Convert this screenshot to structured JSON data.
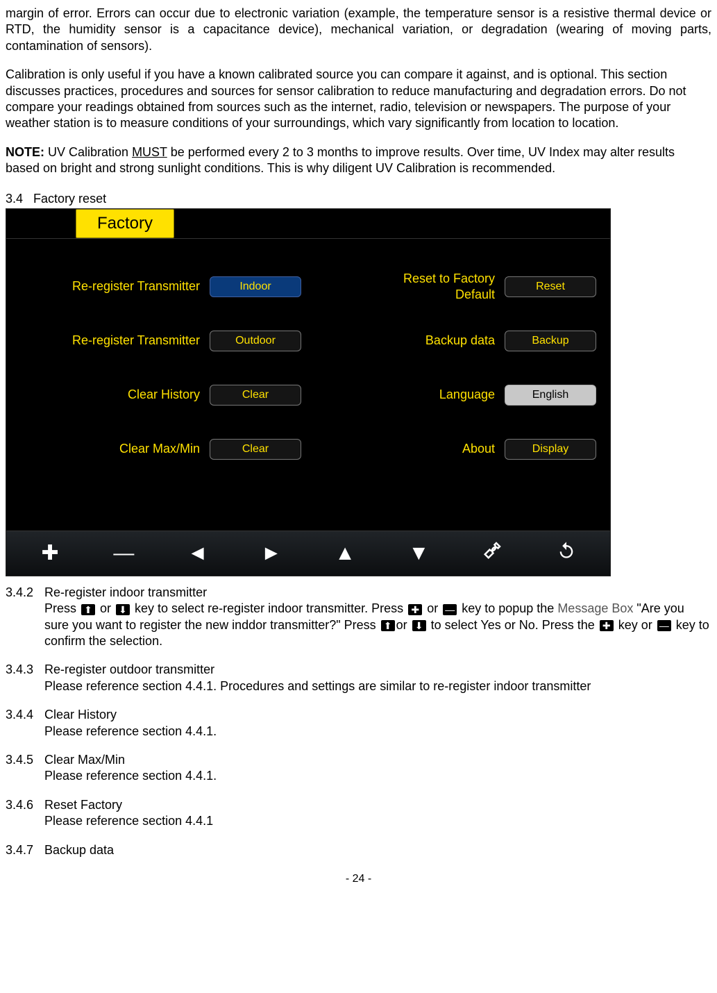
{
  "intro": {
    "p1": "margin of error. Errors can occur due to electronic variation (example, the temperature sensor is a resistive thermal device or RTD, the humidity sensor is a capacitance device), mechanical variation, or degradation (wearing of moving parts, contamination of sensors).",
    "p2": "Calibration is only useful if you have a known calibrated source you can compare it against, and is optional. This section discusses practices, procedures and sources for sensor calibration to reduce manufacturing and degradation errors. Do not compare your readings obtained from sources such as the internet, radio, television or newspapers. The purpose of your weather station is to measure conditions of your surroundings, which vary significantly from location to location.",
    "note_label": "NOTE:",
    "note_pre": " UV Calibration ",
    "note_must": "MUST",
    "note_post": " be performed every 2 to 3 months to improve results. Over time, UV Index may alter results based on bright and strong sunlight conditions. This is why diligent UV Calibration is recommended."
  },
  "section34": {
    "num": "3.4",
    "title": "Factory reset"
  },
  "factory": {
    "tab": "Factory",
    "left": [
      {
        "label": "Re-register Transmitter",
        "button": "Indoor",
        "style": "sel"
      },
      {
        "label": "Re-register Transmitter",
        "button": "Outdoor",
        "style": "dark"
      },
      {
        "label": "Clear History",
        "button": "Clear",
        "style": "dark"
      },
      {
        "label": "Clear Max/Min",
        "button": "Clear",
        "style": "dark"
      }
    ],
    "right": [
      {
        "label": "Reset to Factory\nDefault",
        "button": "Reset",
        "style": "dark"
      },
      {
        "label": "Backup data",
        "button": "Backup",
        "style": "dark"
      },
      {
        "label": "Language",
        "button": "English",
        "style": "light"
      },
      {
        "label": "About",
        "button": "Display",
        "style": "dark"
      }
    ],
    "footerIcons": [
      "plus",
      "minus",
      "arrow-left",
      "arrow-right",
      "arrow-up",
      "arrow-down",
      "wrench",
      "undo"
    ]
  },
  "s342": {
    "num": "3.4.2",
    "title": "Re-register indoor transmitter",
    "t1": "Press ",
    "t2": " or ",
    "t3": "  key to select re-register indoor transmitter. Press ",
    "t4": " or ",
    "t5": " key to popup the ",
    "mb": "Message Box",
    "t6": " \"Are you sure you want to register the new inddor transmitter?\" Press ",
    "t7": "or ",
    "t8": " to select Yes or No. Press the ",
    "t9": " key or ",
    "t10": " key to confirm the selection."
  },
  "s343": {
    "num": "3.4.3",
    "title": "Re-register outdoor transmitter",
    "body": "Please reference section 4.4.1. Procedures and settings are similar to re-register indoor transmitter"
  },
  "s344": {
    "num": "3.4.4",
    "title": "Clear History",
    "body": "Please reference section 4.4.1."
  },
  "s345": {
    "num": "3.4.5",
    "title": "Clear Max/Min",
    "body": "Please reference section 4.4.1."
  },
  "s346": {
    "num": "3.4.6",
    "title": "Reset Factory",
    "body": "Please reference section 4.4.1"
  },
  "s347": {
    "num": "3.4.7",
    "title": "Backup data"
  },
  "pageNum": "- 24 -"
}
